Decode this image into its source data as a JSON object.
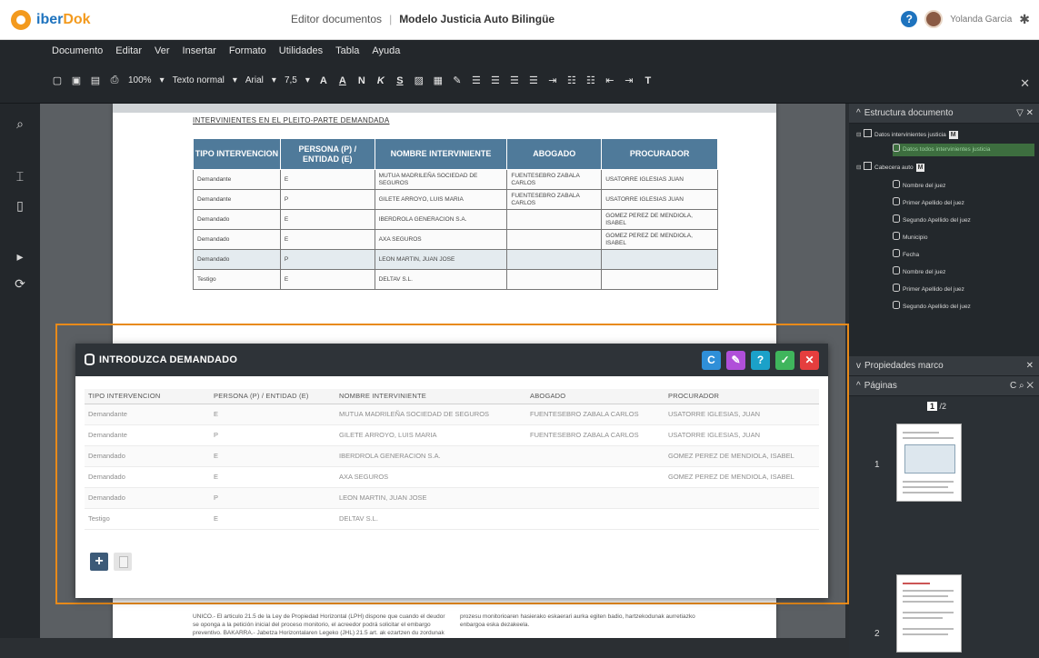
{
  "header": {
    "logo_iber": "iber",
    "logo_dok": "Dok",
    "section": "Editor documentos",
    "separator": "|",
    "document": "Modelo Justicia Auto Bilingüe",
    "user_name": "Yolanda Garcia"
  },
  "menu": [
    "Documento",
    "Editar",
    "Ver",
    "Insertar",
    "Formato",
    "Utilidades",
    "Tabla",
    "Ayuda"
  ],
  "toolbar": {
    "zoom": "100%",
    "style": "Texto normal",
    "font": "Arial",
    "size": "7,5",
    "font_color": "A",
    "highlight": "A",
    "bold": "N",
    "italic": "K",
    "underline": "S",
    "clear_format": "T"
  },
  "document_page": {
    "heading": "INTERVINIENTES EN EL PLEITO-PARTE DEMANDADA",
    "table_headers": [
      "TIPO INTERVENCION",
      "PERSONA (P) / ENTIDAD (E)",
      "NOMBRE INTERVINIENTE",
      "ABOGADO",
      "PROCURADOR"
    ],
    "table_rows": [
      [
        "Demandante",
        "E",
        "MUTUA MADRILEÑA SOCIEDAD DE SEGUROS",
        "FUENTESEBRO ZABALA CARLOS",
        "USATORRE IGLESIAS JUAN"
      ],
      [
        "Demandante",
        "P",
        "GILETE ARROYO, LUIS MARIA",
        "FUENTESEBRO ZABALA CARLOS",
        "USATORRE IGLESIAS JUAN"
      ],
      [
        "Demandado",
        "E",
        "IBERDROLA GENERACION S.A.",
        "",
        "GOMEZ PEREZ DE MENDIOLA, ISABEL"
      ],
      [
        "Demandado",
        "E",
        "AXA SEGUROS",
        "",
        "GOMEZ PEREZ DE MENDIOLA, ISABEL"
      ],
      [
        "Demandado",
        "P",
        "LEON MARTIN, JUAN JOSE",
        "",
        ""
      ],
      [
        "Testigo",
        "E",
        "DELTAV S.L.",
        "",
        ""
      ]
    ],
    "footer_text": "UNICO.- El articulo 21.5 de la Ley de Propiedad Horizontal (LPH) dispone que cuando el deudor se oponga a la petición inicial del proceso monitorio, el acreedor podrá solicitar el embargo preventivo. BAKARRA.- Jabetza Horizontalaren Legeko (JHL) 21.5 art. ak ezartzen du zordunak prozesu monitorioaren hasierako eskaerari aurka egiten badio, hartzekodunak aurretiazko enbargoa eska dezakeela."
  },
  "dialog": {
    "title": "INTRODUZCA DEMANDADO",
    "buttons": {
      "refresh": "C",
      "edit": "✎",
      "help": "?",
      "ok": "✓",
      "cancel": "✕"
    },
    "columns": [
      "TIPO INTERVENCION",
      "PERSONA (P) / ENTIDAD (E)",
      "NOMBRE INTERVINIENTE",
      "ABOGADO",
      "PROCURADOR"
    ],
    "rows": [
      [
        "Demandante",
        "E",
        "MUTUA MADRILEÑA SOCIEDAD DE SEGUROS",
        "FUENTESEBRO ZABALA CARLOS",
        "USATORRE IGLESIAS, JUAN"
      ],
      [
        "Demandante",
        "P",
        "GILETE ARROYO, LUIS MARIA",
        "FUENTESEBRO ZABALA CARLOS",
        "USATORRE IGLESIAS, JUAN"
      ],
      [
        "Demandado",
        "E",
        "IBERDROLA GENERACION S.A.",
        "",
        "GOMEZ PEREZ DE MENDIOLA, ISABEL"
      ],
      [
        "Demandado",
        "E",
        "AXA SEGUROS",
        "",
        "GOMEZ PEREZ DE MENDIOLA, ISABEL"
      ],
      [
        "Demandado",
        "P",
        "LEON MARTIN, JUAN JOSE",
        "",
        ""
      ],
      [
        "Testigo",
        "E",
        "DELTAV S.L.",
        "",
        ""
      ]
    ],
    "add_label": "+"
  },
  "right_panel": {
    "structure_title": "Estructura documento",
    "tree": [
      {
        "label": "Datos intervinientes justicia",
        "type": "box",
        "badge": "M",
        "expander": "⊟"
      },
      {
        "label": "Datos todos intervinientes justicia",
        "type": "db",
        "selected": true
      },
      {
        "label": "Cabecera auto",
        "type": "box",
        "badge": "M",
        "expander": "⊟"
      },
      {
        "label": "Nombre del juez",
        "type": "db"
      },
      {
        "label": "Primer Apellido del juez",
        "type": "db"
      },
      {
        "label": "Segundo Apellido del juez",
        "type": "db"
      },
      {
        "label": "Municipio",
        "type": "db"
      },
      {
        "label": "Fecha",
        "type": "db"
      },
      {
        "label": "Nombre del juez",
        "type": "db"
      },
      {
        "label": "Primer Apellido del juez",
        "type": "db"
      },
      {
        "label": "Segundo Apellido del juez",
        "type": "db"
      }
    ],
    "properties_title": "Propiedades marco",
    "pages_title": "Páginas",
    "current_page": "1",
    "total_pages": "/2",
    "page_numbers": [
      "1",
      "2"
    ]
  },
  "colors": {
    "accent_orange": "#e88a1a",
    "brand_blue": "#1e73be",
    "brand_orange": "#f39a1e"
  }
}
